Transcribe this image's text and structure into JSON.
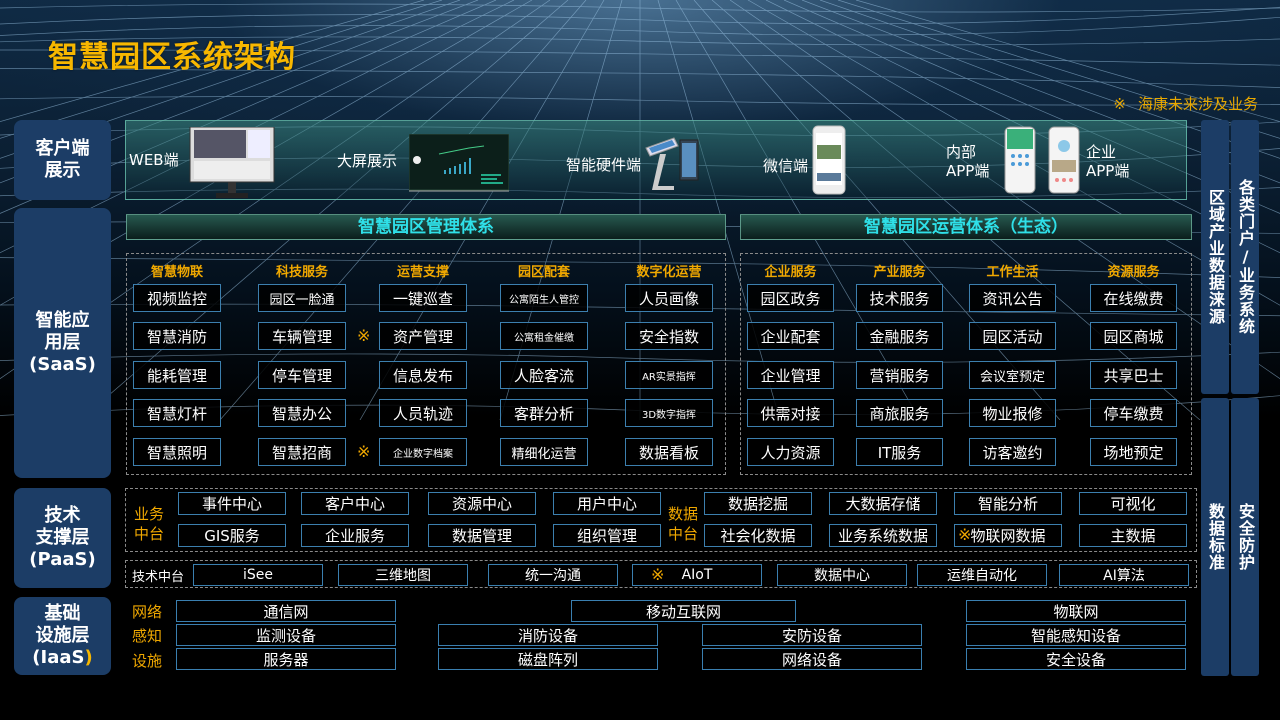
{
  "title": "智慧园区系统架构",
  "note": {
    "mark": "※",
    "text": "海康未来涉及业务"
  },
  "colors": {
    "title": "#f7b700",
    "accent_cyan": "#2fe0e8",
    "orange": "#f0a800",
    "label_bg": "#1c3d66",
    "box_border": "#3c7fae"
  },
  "layers": {
    "client": {
      "line1": "客户端",
      "line2": "展示"
    },
    "saas": {
      "line1": "智能应",
      "line2": "用层",
      "line3": "(SaaS)"
    },
    "paas": {
      "line1": "技术",
      "line2": "支撑层",
      "line3": "(PaaS)"
    },
    "iaas": {
      "line1": "基础",
      "line2": "设施层",
      "line3a": "(IaaS",
      "line3b": ")"
    }
  },
  "client_items": {
    "web": "WEB端",
    "bigscreen": "大屏展示",
    "hardware": "智能硬件端",
    "wechat": "微信端",
    "internal_app_1": "内部",
    "internal_app_2": "APP端",
    "enterprise_app_1": "企业",
    "enterprise_app_2": "APP端"
  },
  "management": {
    "title": "智慧园区管理体系",
    "columns": [
      {
        "head": "智慧物联",
        "items": [
          "视频监控",
          "智慧消防",
          "能耗管理",
          "智慧灯杆",
          "智慧照明"
        ]
      },
      {
        "head": "科技服务",
        "items": [
          "园区一脸通",
          "车辆管理",
          "停车管理",
          "智慧办公",
          "智慧招商"
        ]
      },
      {
        "head": "运营支撑",
        "items": [
          "一键巡查",
          "资产管理",
          "信息发布",
          "人员轨迹",
          "企业数字档案"
        ]
      },
      {
        "head": "园区配套",
        "items": [
          "公寓陌生人管控",
          "公寓租金催缴",
          "人脸客流",
          "客群分析",
          "精细化运营"
        ]
      },
      {
        "head": "数字化运营",
        "items": [
          "人员画像",
          "安全指数",
          "AR实景指挥",
          "3D数字指挥",
          "数据看板"
        ]
      }
    ],
    "star": "※"
  },
  "operation": {
    "title": "智慧园区运营体系（生态）",
    "columns": [
      {
        "head": "企业服务",
        "items": [
          "园区政务",
          "企业配套",
          "企业管理",
          "供需对接",
          "人力资源"
        ]
      },
      {
        "head": "产业服务",
        "items": [
          "技术服务",
          "金融服务",
          "营销服务",
          "商旅服务",
          "IT服务"
        ]
      },
      {
        "head": "工作生活",
        "items": [
          "资讯公告",
          "园区活动",
          "会议室预定",
          "物业报修",
          "访客邀约"
        ]
      },
      {
        "head": "资源服务",
        "items": [
          "在线缴费",
          "园区商城",
          "共享巴士",
          "停车缴费",
          "场地预定"
        ]
      }
    ]
  },
  "paas": {
    "business_label_1": "业务",
    "business_label_2": "中台",
    "business_row1": [
      "事件中心",
      "客户中心",
      "资源中心",
      "用户中心"
    ],
    "business_row2": [
      "GIS服务",
      "企业服务",
      "数据管理",
      "组织管理"
    ],
    "data_label_1": "数据",
    "data_label_2": "中台",
    "data_row1": [
      "数据挖掘",
      "大数据存储",
      "智能分析",
      "可视化"
    ],
    "data_row2": [
      "社会化数据",
      "业务系统数据",
      "物联网数据",
      "主数据"
    ],
    "tech_label": "技术中台",
    "tech_items": [
      "iSee",
      "三维地图",
      "统一沟通",
      "AIoT",
      "数据中心",
      "运维自动化",
      "AI算法"
    ],
    "star": "※"
  },
  "iaas": {
    "labels": [
      "网络",
      "感知",
      "设施"
    ],
    "network": [
      "通信网",
      "移动互联网",
      "物联网"
    ],
    "sensing": [
      "监测设备",
      "消防设备",
      "安防设备",
      "智能感知设备"
    ],
    "facility": [
      "服务器",
      "磁盘阵列",
      "网络设备",
      "安全设备"
    ]
  },
  "side_bars": {
    "regional_data": "区域产业数据涞源",
    "portals": "各类门户/业务系统",
    "data_standard": "数据标准",
    "security": "安全防护"
  }
}
